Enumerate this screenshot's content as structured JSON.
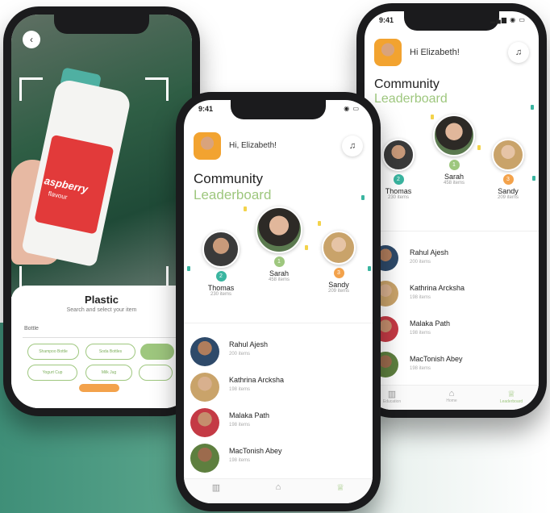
{
  "scan_screen": {
    "brand_text": "aspberry",
    "label_sub": "flavour",
    "sheet_title": "Plastic",
    "sheet_subtitle": "Search and select your item",
    "search_value": "Bottle",
    "chips": [
      "Shampoo Bottle",
      "Soda Bottles",
      "",
      "Yogurt Cup",
      "Milk Jug",
      ""
    ]
  },
  "leaderboard_front": {
    "time": "9:41",
    "greeting": "Hi, Elizabeth!",
    "title_line1": "Community",
    "title_line2": "Leaderboard",
    "podium": [
      {
        "name": "Thomas",
        "items": "230 items",
        "rank": "2"
      },
      {
        "name": "Sarah",
        "items": "458 items",
        "rank": "1"
      },
      {
        "name": "Sandy",
        "items": "209 items",
        "rank": "3"
      }
    ],
    "list": [
      {
        "name": "Rahul Ajesh",
        "items": "200 items"
      },
      {
        "name": "Kathrina Arcksha",
        "items": "198 items"
      },
      {
        "name": "Malaka Path",
        "items": "198 items"
      },
      {
        "name": "MacTonish Abey",
        "items": "198 items"
      }
    ]
  },
  "leaderboard_back": {
    "time": "9:41",
    "greeting": "Hi Elizabeth!",
    "title_line1": "Community",
    "title_line2": "Leaderboard",
    "podium": [
      {
        "name": "Thomas",
        "items": "230 items",
        "rank": "2"
      },
      {
        "name": "Sarah",
        "items": "458 items",
        "rank": "1"
      },
      {
        "name": "Sandy",
        "items": "209 items",
        "rank": "3"
      }
    ],
    "list": [
      {
        "name": "Rahul Ajesh",
        "items": "200 items"
      },
      {
        "name": "Kathrina Arcksha",
        "items": "198 items"
      },
      {
        "name": "Malaka Path",
        "items": "198 items"
      },
      {
        "name": "MacTonish Abey",
        "items": "198 items"
      }
    ],
    "tabs": [
      "Education",
      "Home",
      "Leaderboard"
    ]
  },
  "colors": {
    "accent_green": "#9ec77e",
    "rank1": "#9ec77e",
    "rank2": "#3ab5a0",
    "rank3": "#f3a24b"
  },
  "icons": [
    "back-icon",
    "bell-icon",
    "book-icon",
    "home-icon",
    "trophy-icon"
  ]
}
